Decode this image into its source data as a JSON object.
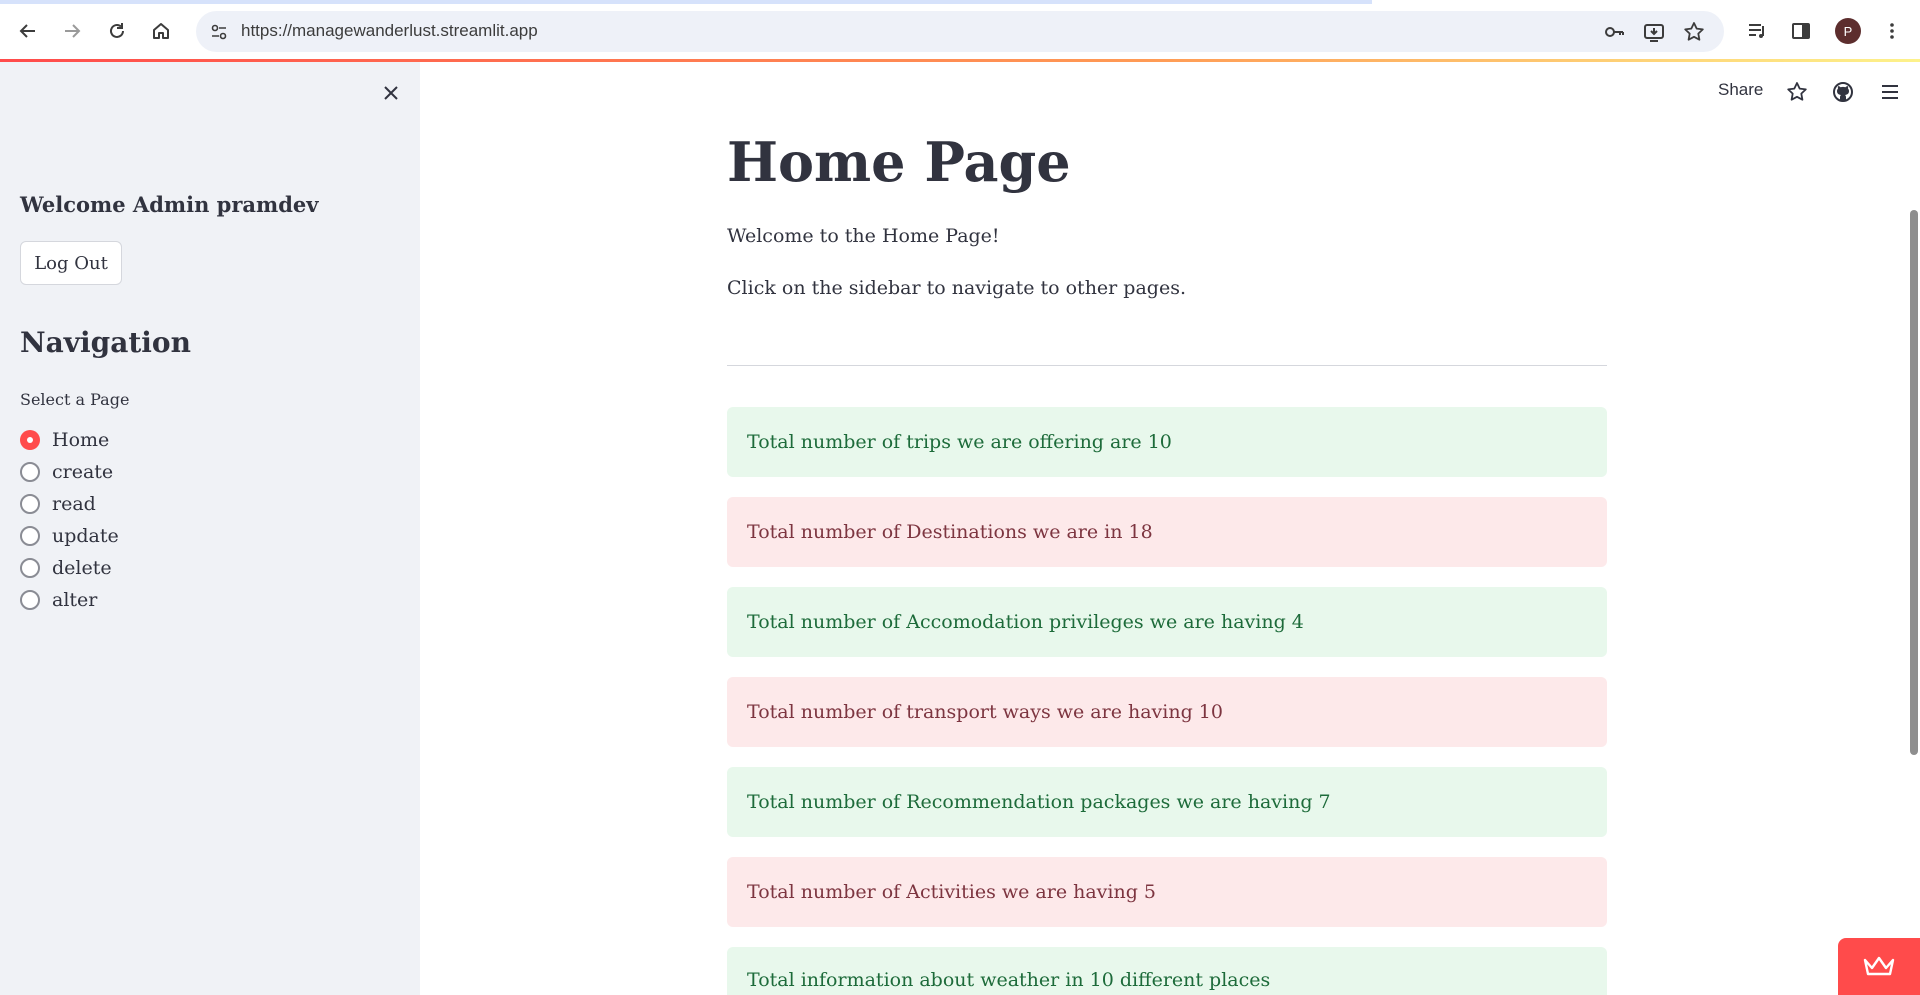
{
  "browser": {
    "url": "https://managewanderlust.streamlit.app",
    "profile_initial": "P"
  },
  "sidebar": {
    "welcome": "Welcome Admin pramdev",
    "logout_label": "Log Out",
    "nav_title": "Navigation",
    "select_label": "Select a Page",
    "pages": [
      "Home",
      "create",
      "read",
      "update",
      "delete",
      "alter"
    ],
    "selected_page": "Home"
  },
  "toolbar": {
    "share_label": "Share"
  },
  "main": {
    "title": "Home Page",
    "intro": "Welcome to the Home Page!",
    "hint": "Click on the sidebar to navigate to other pages.",
    "alerts": [
      {
        "text": "Total number of trips we are offering are 10",
        "kind": "success"
      },
      {
        "text": "Total number of Destinations we are in 18",
        "kind": "error"
      },
      {
        "text": "Total number of Accomodation privileges we are having 4",
        "kind": "success"
      },
      {
        "text": "Total number of transport ways we are having 10",
        "kind": "error"
      },
      {
        "text": "Total number of Recommendation packages we are having 7",
        "kind": "success"
      },
      {
        "text": "Total number of Activities we are having 5",
        "kind": "error"
      },
      {
        "text": "Total information about weather in 10 different places",
        "kind": "success"
      }
    ]
  },
  "colors": {
    "accent": "#ff4b4b",
    "success_bg": "#e8f8ec",
    "error_bg": "#fde9ea"
  }
}
